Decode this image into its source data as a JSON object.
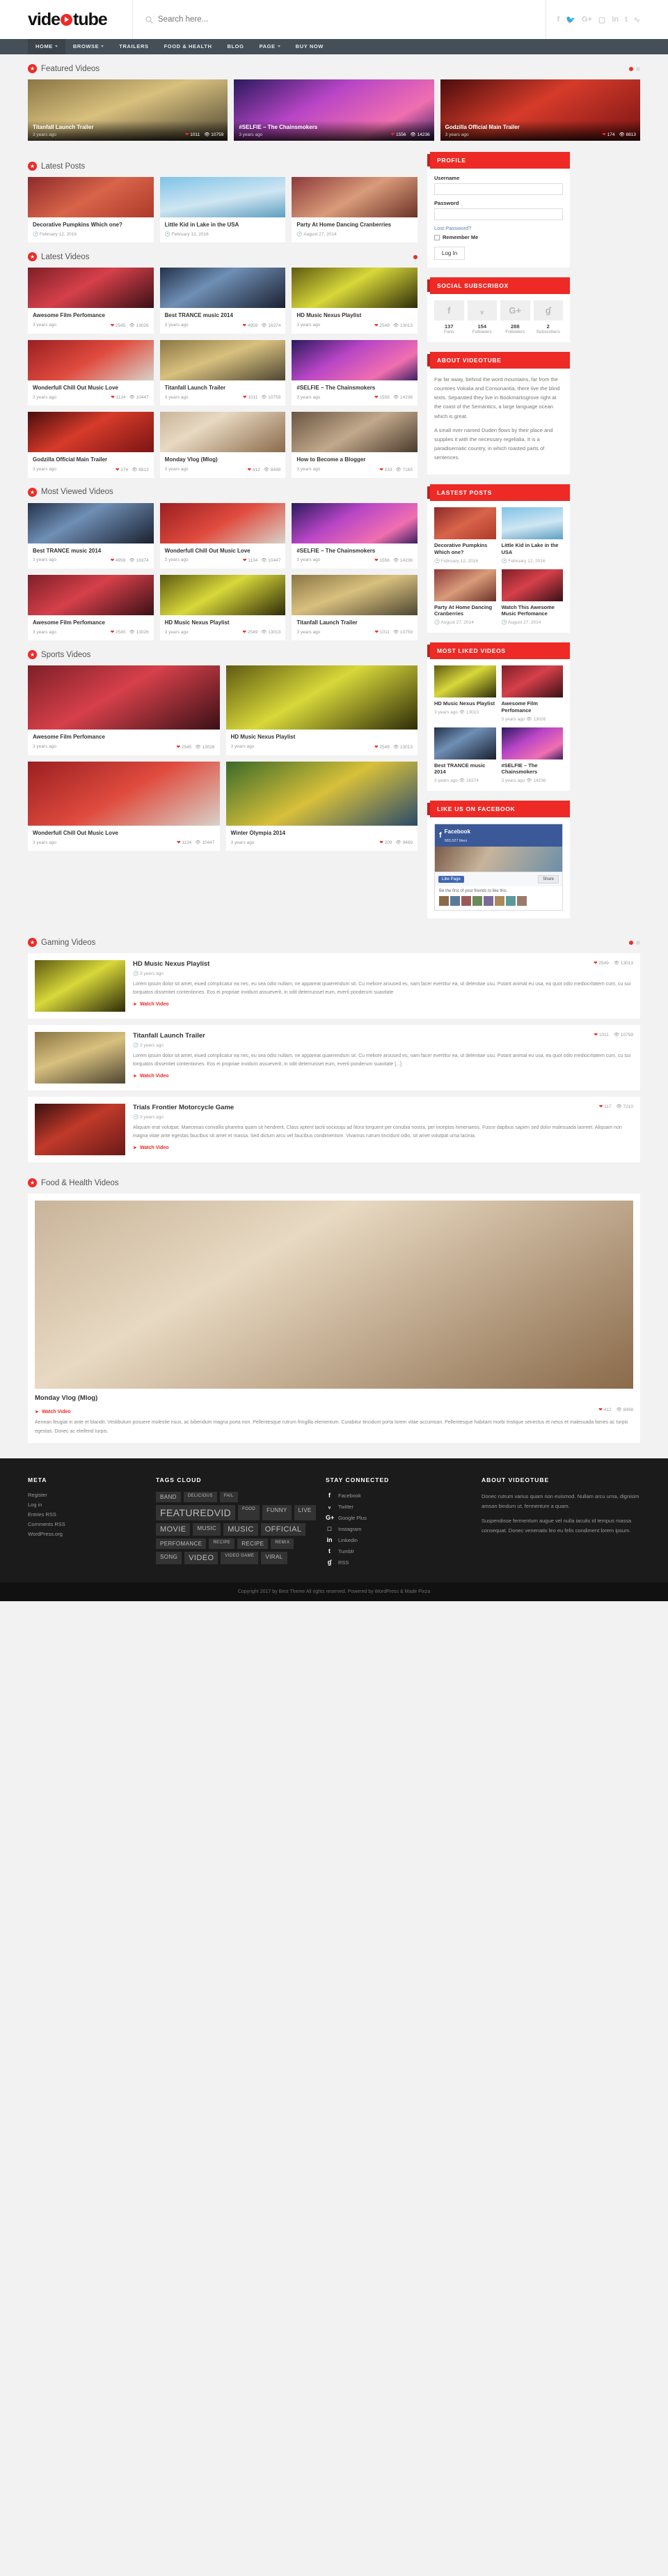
{
  "site": {
    "logo_text_1": "vide",
    "logo_text_2": "tube",
    "search_placeholder": "Search here...",
    "social": [
      "f",
      "ᵥ",
      "G+",
      "□",
      "in",
      "t",
      "ɠ"
    ]
  },
  "nav": [
    {
      "label": "HOME",
      "caret": true,
      "active": true
    },
    {
      "label": "BROWSE",
      "caret": true,
      "active": false
    },
    {
      "label": "TRAILERS",
      "caret": false,
      "active": false
    },
    {
      "label": "FOOD & HEALTH",
      "caret": false,
      "active": false
    },
    {
      "label": "BLOG",
      "caret": false,
      "active": false
    },
    {
      "label": "PAGE",
      "caret": true,
      "active": false
    },
    {
      "label": "BUY NOW",
      "caret": false,
      "active": false
    }
  ],
  "sections": {
    "featured": "Featured Videos",
    "latest_posts": "Latest Posts",
    "latest_videos": "Latest Videos",
    "most_viewed": "Most Viewed Videos",
    "sports": "Sports Videos",
    "gaming": "Gaming Videos",
    "food": "Food & Health Videos"
  },
  "featured": [
    {
      "title": "Titanfall Launch Trailer",
      "date": "3 years ago",
      "likes": "1011",
      "views": "10759",
      "bg": "fall"
    },
    {
      "title": "#SELFIE – The Chainsmokers",
      "date": "3 years ago",
      "likes": "1556",
      "views": "14236",
      "bg": "selfie"
    },
    {
      "title": "Godzilla Official Main Trailer",
      "date": "3 years ago",
      "likes": "174",
      "views": "8813",
      "bg": "godzilla"
    }
  ],
  "latest_posts": [
    {
      "title": "Decorative Pumpkins Which one?",
      "date": "February 12, 2016",
      "bg": "pumpkin"
    },
    {
      "title": "Little Kid in Lake in the USA",
      "date": "February 12, 2016",
      "bg": "lake"
    },
    {
      "title": "Party At Home Dancing Cranberries",
      "date": "August 27, 2014",
      "bg": "party"
    }
  ],
  "latest_videos": [
    {
      "title": "Awesome Film Perfomance",
      "date": "3 years ago",
      "likes": "2545",
      "views": "13026",
      "bg": "perf"
    },
    {
      "title": "Best TRANCE music 2014",
      "date": "3 years ago",
      "likes": "4959",
      "views": "16374",
      "bg": "trance"
    },
    {
      "title": "HD Music Nexus Playlist",
      "date": "3 years ago",
      "likes": "2549",
      "views": "13013",
      "bg": "nexus"
    },
    {
      "title": "Wonderfull Chill Out Music Love",
      "date": "3 years ago",
      "likes": "1134",
      "views": "10447",
      "bg": "chill"
    },
    {
      "title": "Titanfall Launch Trailer",
      "date": "3 years ago",
      "likes": "1011",
      "views": "10759",
      "bg": "fall"
    },
    {
      "title": "#SELFIE – The Chainsmokers",
      "date": "3 years ago",
      "likes": "1556",
      "views": "14236",
      "bg": "selfie"
    },
    {
      "title": "Godzilla Official Main Trailer",
      "date": "3 years ago",
      "likes": "174",
      "views": "8813",
      "bg": "godzilla"
    },
    {
      "title": "Monday Vlog (Mlog)",
      "date": "3 years ago",
      "likes": "412",
      "views": "8498",
      "bg": "food"
    },
    {
      "title": "How to Become a Blogger",
      "date": "3 years ago",
      "likes": "233",
      "views": "7165",
      "bg": "blogger"
    }
  ],
  "most_viewed": [
    {
      "title": "Best TRANCE music 2014",
      "date": "3 years ago",
      "likes": "4959",
      "views": "16374",
      "bg": "trance"
    },
    {
      "title": "Wonderfull Chill Out Music Love",
      "date": "3 years ago",
      "likes": "1134",
      "views": "10447",
      "bg": "chill"
    },
    {
      "title": "#SELFIE – The Chainsmokers",
      "date": "3 years ago",
      "likes": "1556",
      "views": "14236",
      "bg": "selfie"
    },
    {
      "title": "Awesome Film Perfomance",
      "date": "3 years ago",
      "likes": "2545",
      "views": "13026",
      "bg": "perf"
    },
    {
      "title": "HD Music Nexus Playlist",
      "date": "3 years ago",
      "likes": "2549",
      "views": "13013",
      "bg": "nexus"
    },
    {
      "title": "Titanfall Launch Trailer",
      "date": "3 years ago",
      "likes": "1011",
      "views": "10759",
      "bg": "fall"
    }
  ],
  "sports": [
    {
      "title": "Awesome Film Perfomance",
      "date": "3 years ago",
      "likes": "2545",
      "views": "13026",
      "bg": "perf"
    },
    {
      "title": "HD Music Nexus Playlist",
      "date": "3 years ago",
      "likes": "2549",
      "views": "13013",
      "bg": "nexus"
    },
    {
      "title": "Wonderfull Chill Out Music Love",
      "date": "3 years ago",
      "likes": "1134",
      "views": "10447",
      "bg": "chill"
    },
    {
      "title": "Winter Olympia 2014",
      "date": "3 years ago",
      "likes": "209",
      "views": "9469",
      "bg": "olympia"
    }
  ],
  "gaming": [
    {
      "title": "HD Music Nexus Playlist",
      "date": "3 years ago",
      "likes": "2549",
      "views": "13013",
      "bg": "nexus",
      "excerpt": "Lorem ipsum dolor sit amet, eiued complicatur ea nec, eu sea odio nullam, ne appareat quaerendum sit. Cu meliore aroused es, nam facer evertitur ea, ut delenitae usu. Putant animal eu usa, ea quot odio mediocritatem cum, cu sui torquatos dissentiet contentiones. Eos ei propriae invidunt assueverit, in odit deterruisset eum, everti ponderum suavitate",
      "watch": "Watch Video"
    },
    {
      "title": "Titanfall Launch Trailer",
      "date": "3 years ago",
      "likes": "1011",
      "views": "10759",
      "bg": "fall",
      "excerpt": "Lorem ipsum dolor sit amet, eiued complicatur ea nec, eu sea odio nullam, ne appareat quaerendum sit. Cu meliore aroused es, nam facer evertitur ea, ut delenitae usu. Putant animal eu usa, ea quot odio mediocritatem cum, cu sui torquatos dissentiet contentiones. Eos ei propriae invidunt assueverit, in odit deterruisset eum, everti ponderum suavitate [...]",
      "watch": "Watch Video"
    },
    {
      "title": "Trials Frontier Motorcycle Game",
      "date": "3 years ago",
      "likes": "117",
      "views": "7210",
      "bg": "trials",
      "excerpt": "Aliquam erat volutpat. Maecenas convallis pharetra quam sit hendrerit. Class aptent taciti sociosqu ad litora torquent per conubia nostra, per inceptos himenaeos. Fusce dapibus sapien sed dolor malesuada laoreet. Aliquam non magna vitae ante egestas faucibus sit amet et massa. Sed dictum arcu vel faucibus condimentum. Vivamus rutrum tincidunt odio, sit amet volutpat urna lacinia.",
      "watch": "Watch Video"
    }
  ],
  "food": {
    "title": "Monday Vlog (Mlog)",
    "likes": "412",
    "views": "8498",
    "bg": "food",
    "watch": "Watch Video",
    "excerpt": "Aenean feugiat in ante et blandit. Vestibulum posuere molestie risus, ac bibendum magna porta non. Pellentesque rutrum fringilla elementum. Curabitur tincidunt porta lorem vitae accumsan. Pellentesque habitant morbi tristique senectus et netus et malesuada fames ac turpis egestas. Donec ac eleifend turpis."
  },
  "sidebar": {
    "profile": {
      "title": "PROFILE",
      "username_label": "Username",
      "password_label": "Password",
      "lost_password": "Lost Password?",
      "remember": "Remember Me",
      "login": "Log In"
    },
    "social_subscribox": {
      "title": "SOCIAL SUBSCRIBOX",
      "items": [
        {
          "icon": "facebook-icon",
          "glyph": "f",
          "count": "137",
          "label": "Fans"
        },
        {
          "icon": "twitter-icon",
          "glyph": "ᵥ",
          "count": "154",
          "label": "Followers"
        },
        {
          "icon": "google-plus-icon",
          "glyph": "G+",
          "count": "288",
          "label": "Followers"
        },
        {
          "icon": "rss-icon",
          "glyph": "ɠ",
          "count": "2",
          "label": "Subscribers"
        }
      ]
    },
    "about": {
      "title": "ABOUT VIDEOTUBE",
      "p1": "Far far away, behind the word mountains, far from the countries Vokalia and Consonantia, there live the blind texts. Separated they live in Bookmarksgrove right at the coast of the Semantics, a large language ocean which is great.",
      "p2": "A small river named Duden flows by their place and supplies it with the necessary regelialia. It is a paradisematic country, in which roasted parts of sentences."
    },
    "lastest_posts": {
      "title": "LASTEST POSTS",
      "items": [
        {
          "title": "Decorative Pumpkins Which one?",
          "date": "February 12, 2016",
          "bg": "pumpkin"
        },
        {
          "title": "Little Kid in Lake in the USA",
          "date": "February 12, 2016",
          "bg": "lake"
        },
        {
          "title": "Party At Home Dancing Cranberries",
          "date": "August 27, 2014",
          "bg": "party"
        },
        {
          "title": "Watch This Awesome Music Perfomance",
          "date": "August 27, 2014",
          "bg": "perf"
        }
      ]
    },
    "most_liked": {
      "title": "MOST LIKED VIDEOS",
      "items": [
        {
          "title": "HD Music Nexus Playlist",
          "date": "3 years ago",
          "views": "13013",
          "bg": "nexus"
        },
        {
          "title": "Awesome Film Perfomance",
          "date": "3 years ago",
          "views": "13026",
          "bg": "perf"
        },
        {
          "title": "Best TRANCE music 2014",
          "date": "3 years ago",
          "views": "16374",
          "bg": "trance"
        },
        {
          "title": "#SELFIE – The Chainsmokers",
          "date": "3 years ago",
          "views": "14236",
          "bg": "selfie"
        }
      ]
    },
    "facebook": {
      "title": "LIKE US ON FACEBOOK",
      "page_name": "Facebook",
      "page_likes": "983,027 likes",
      "like_btn": "Like Page",
      "share_btn": "Share",
      "promo": "Be the first of your friends to like this"
    }
  },
  "footer": {
    "meta": {
      "title": "META",
      "links": [
        "Register",
        "Log in",
        "Entries RSS",
        "Comments RSS",
        "WordPress.org"
      ]
    },
    "tags": {
      "title": "TAGS CLOUD",
      "items": [
        {
          "t": "BAND",
          "s": "m"
        },
        {
          "t": "DELICIOUS",
          "s": ""
        },
        {
          "t": "FAIL",
          "s": ""
        },
        {
          "t": "FEATUREDVID",
          "s": "xl"
        },
        {
          "t": "FOOD",
          "s": ""
        },
        {
          "t": "FUNNY",
          "s": "m"
        },
        {
          "t": "LIVE",
          "s": "m"
        },
        {
          "t": "MOVIE",
          "s": "l"
        },
        {
          "t": "MUSIC",
          "s": "m"
        },
        {
          "t": "MUSIC",
          "s": "l"
        },
        {
          "t": "OFFICIAL",
          "s": "l"
        },
        {
          "t": "PERFOMANCE",
          "s": "m"
        },
        {
          "t": "RECIPE",
          "s": ""
        },
        {
          "t": "RECIPE",
          "s": "m"
        },
        {
          "t": "REMIX",
          "s": ""
        },
        {
          "t": "SONG",
          "s": "m"
        },
        {
          "t": "VIDEO",
          "s": "l"
        },
        {
          "t": "VIDEO GAME",
          "s": ""
        },
        {
          "t": "VIRAL",
          "s": "m"
        }
      ]
    },
    "connected": {
      "title": "STAY CONNECTED",
      "items": [
        {
          "glyph": "f",
          "label": "Facebook"
        },
        {
          "glyph": "ᵥ",
          "label": "Twitter"
        },
        {
          "glyph": "G+",
          "label": "Google Plus"
        },
        {
          "glyph": "□",
          "label": "Instagram"
        },
        {
          "glyph": "in",
          "label": "Linkedin"
        },
        {
          "glyph": "t",
          "label": "Tumblr"
        },
        {
          "glyph": "ɠ",
          "label": "RSS"
        }
      ]
    },
    "about": {
      "title": "ABOUT VIDEOTUBE",
      "p1": "Donec rutrum varius quam non euismod. Nullam arcu urna, dignisim amsan bindum ut, fermentum a quam.",
      "p2": "Suspendisse fermentum augue vel nulla iaculis id tempus massa consequat. Donec venenatis leo eu felis condiment lorem ipsum."
    },
    "copyright": "Copyright 2017 by Best Theme All rights reserved. Powered by WordPress & Made Pixza"
  },
  "colors": {
    "accent": "#ed2a26",
    "nav": "#454f57",
    "footer": "#1b1b1b"
  }
}
